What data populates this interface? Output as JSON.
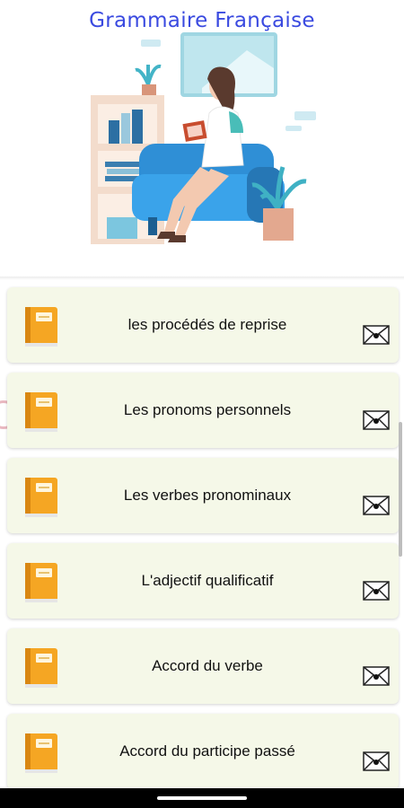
{
  "header": {
    "title": "Grammaire Française"
  },
  "lessons": [
    {
      "label": "les procédés de reprise"
    },
    {
      "label": "Les pronoms personnels"
    },
    {
      "label": "Les verbes pronominaux"
    },
    {
      "label": "L'adjectif qualificatif"
    },
    {
      "label": "Accord du verbe"
    },
    {
      "label": "Accord du participe passé"
    }
  ],
  "icons": {
    "lesson": "book-icon",
    "action": "mail-icon"
  },
  "colors": {
    "title": "#3a4ae0",
    "card_background": "#f5f8e8",
    "book": "#f5a623"
  }
}
